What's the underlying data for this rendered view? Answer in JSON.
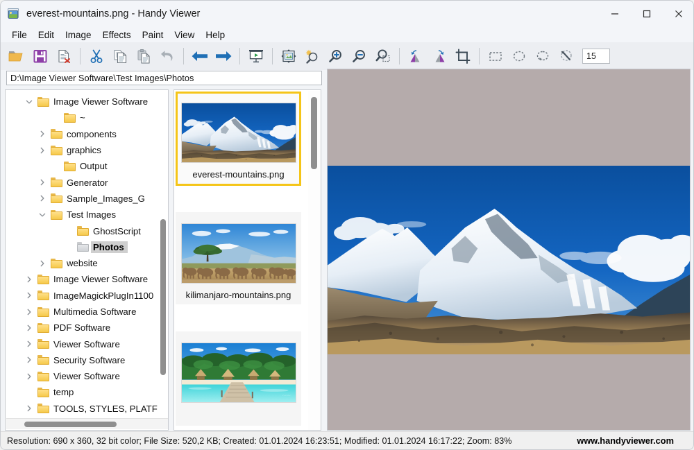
{
  "window": {
    "title": "everest-mountains.png - Handy Viewer",
    "icon": "photo-icon",
    "controls": [
      {
        "name": "minimize-button",
        "glyph": "minimize"
      },
      {
        "name": "maximize-button",
        "glyph": "maximize"
      },
      {
        "name": "close-button",
        "glyph": "close"
      }
    ]
  },
  "menubar": {
    "items": [
      "File",
      "Edit",
      "Image",
      "Effects",
      "Paint",
      "View",
      "Help"
    ]
  },
  "toolbar": {
    "zoom_value": "15",
    "buttons": [
      {
        "name": "open-file-icon",
        "title": "Open"
      },
      {
        "name": "save-icon",
        "title": "Save"
      },
      {
        "name": "delete-file-icon",
        "title": "Delete"
      },
      {
        "name": "separator",
        "title": ""
      },
      {
        "name": "cut-icon",
        "title": "Cut"
      },
      {
        "name": "copy-icon",
        "title": "Copy"
      },
      {
        "name": "paste-icon",
        "title": "Paste"
      },
      {
        "name": "undo-icon",
        "title": "Undo"
      },
      {
        "name": "separator",
        "title": ""
      },
      {
        "name": "previous-image-icon",
        "title": "Previous"
      },
      {
        "name": "next-image-icon",
        "title": "Next"
      },
      {
        "name": "separator",
        "title": ""
      },
      {
        "name": "slideshow-icon",
        "title": "Slideshow"
      },
      {
        "name": "separator",
        "title": ""
      },
      {
        "name": "fit-to-window-icon",
        "title": "Fit to window"
      },
      {
        "name": "adjust-brightness-icon",
        "title": "Adjust"
      },
      {
        "name": "zoom-in-icon",
        "title": "Zoom in"
      },
      {
        "name": "zoom-out-icon",
        "title": "Zoom out"
      },
      {
        "name": "zoom-selection-icon",
        "title": "Zoom selection"
      },
      {
        "name": "separator",
        "title": ""
      },
      {
        "name": "rotate-left-icon",
        "title": "Rotate left"
      },
      {
        "name": "rotate-right-icon",
        "title": "Rotate right"
      },
      {
        "name": "crop-icon",
        "title": "Crop"
      },
      {
        "name": "separator",
        "title": ""
      },
      {
        "name": "rectangle-select-icon",
        "title": "Rectangle select"
      },
      {
        "name": "ellipse-select-icon",
        "title": "Ellipse select"
      },
      {
        "name": "lasso-select-icon",
        "title": "Lasso select"
      },
      {
        "name": "magic-wand-icon",
        "title": "Magic wand"
      }
    ]
  },
  "address": {
    "value": "D:\\Image Viewer Software\\Test Images\\Photos",
    "placeholder": "Path"
  },
  "tree": {
    "items": [
      {
        "label": "Image Viewer Software",
        "indent": 1,
        "twisty": "expanded",
        "selected": false,
        "folder": "yellow"
      },
      {
        "label": "~",
        "indent": 3,
        "twisty": "none",
        "selected": false,
        "folder": "yellow"
      },
      {
        "label": "components",
        "indent": 2,
        "twisty": "collapsed",
        "selected": false,
        "folder": "yellow"
      },
      {
        "label": "graphics",
        "indent": 2,
        "twisty": "collapsed",
        "selected": false,
        "folder": "yellow"
      },
      {
        "label": "Output",
        "indent": 3,
        "twisty": "none",
        "selected": false,
        "folder": "yellow"
      },
      {
        "label": "Generator",
        "indent": 2,
        "twisty": "collapsed",
        "selected": false,
        "folder": "yellow"
      },
      {
        "label": "Sample_Images_G",
        "indent": 2,
        "twisty": "collapsed",
        "selected": false,
        "folder": "yellow"
      },
      {
        "label": "Test Images",
        "indent": 2,
        "twisty": "expanded",
        "selected": false,
        "folder": "yellow"
      },
      {
        "label": "GhostScript",
        "indent": 4,
        "twisty": "none",
        "selected": false,
        "folder": "yellow"
      },
      {
        "label": "Photos",
        "indent": 4,
        "twisty": "none",
        "selected": true,
        "folder": "grey"
      },
      {
        "label": "website",
        "indent": 2,
        "twisty": "collapsed",
        "selected": false,
        "folder": "yellow"
      },
      {
        "label": "Image Viewer Software ",
        "indent": 1,
        "twisty": "collapsed",
        "selected": false,
        "folder": "yellow"
      },
      {
        "label": "ImageMagickPlugIn1100",
        "indent": 1,
        "twisty": "collapsed",
        "selected": false,
        "folder": "yellow"
      },
      {
        "label": "Multimedia Software",
        "indent": 1,
        "twisty": "collapsed",
        "selected": false,
        "folder": "yellow"
      },
      {
        "label": "PDF Software",
        "indent": 1,
        "twisty": "collapsed",
        "selected": false,
        "folder": "yellow"
      },
      {
        "label": "Viewer Software",
        "indent": 1,
        "twisty": "collapsed",
        "selected": false,
        "folder": "yellow"
      },
      {
        "label": "Security  Software",
        "indent": 1,
        "twisty": "collapsed",
        "selected": false,
        "folder": "yellow"
      },
      {
        "label": " Viewer Software",
        "indent": 1,
        "twisty": "collapsed",
        "selected": false,
        "folder": "yellow"
      },
      {
        "label": "temp",
        "indent": 1,
        "twisty": "none",
        "selected": false,
        "folder": "yellow"
      },
      {
        "label": "TOOLS, STYLES, PLATF",
        "indent": 1,
        "twisty": "collapsed",
        "selected": false,
        "folder": "yellow"
      }
    ]
  },
  "thumbnails": {
    "items": [
      {
        "name": "everest-mountains.png",
        "selected": true,
        "image": "everest"
      },
      {
        "name": "kilimanjaro-mountains.png",
        "selected": false,
        "image": "kilimanjaro"
      },
      {
        "name": "",
        "selected": false,
        "image": "beach"
      }
    ]
  },
  "preview": {
    "image": "everest",
    "background_color": "#b5abab"
  },
  "statusbar": {
    "text": "Resolution: 690 x 360, 32 bit color; File Size: 520,2 KB; Created: 01.01.2024 16:23:51; Modified: 01.01.2024 16:17:22; Zoom: 83%",
    "url": "www.handyviewer.com"
  },
  "colors": {
    "selection_highlight": "#f5c518",
    "titlebar": "#f3f5f9",
    "toolbar": "#eceef2",
    "accent_blue": "#1f6fb5",
    "accent_purple": "#8e3fa8"
  }
}
